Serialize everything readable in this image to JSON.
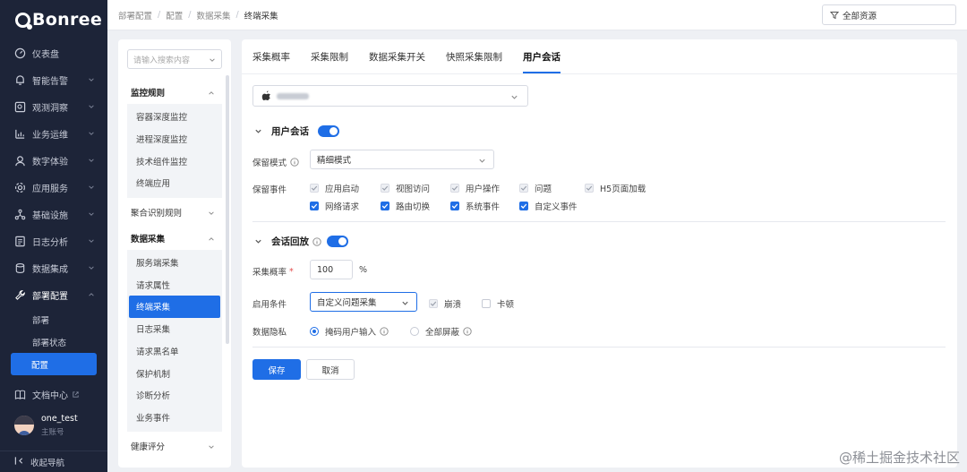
{
  "app": {
    "logo_text": "Bonree"
  },
  "nav": {
    "items": [
      {
        "label": "仪表盘",
        "icon": "dashboard-icon"
      },
      {
        "label": "智能告警",
        "icon": "alarm-icon"
      },
      {
        "label": "观测洞察",
        "icon": "insight-icon"
      },
      {
        "label": "业务运维",
        "icon": "chart-icon"
      },
      {
        "label": "数字体验",
        "icon": "experience-icon"
      },
      {
        "label": "应用服务",
        "icon": "app-service-icon"
      },
      {
        "label": "基础设施",
        "icon": "infrastructure-icon"
      },
      {
        "label": "日志分析",
        "icon": "log-icon"
      },
      {
        "label": "数据集成",
        "icon": "database-icon"
      },
      {
        "label": "部署配置",
        "icon": "wrench-icon"
      }
    ],
    "sub_items": [
      {
        "label": "部署"
      },
      {
        "label": "部署状态"
      },
      {
        "label": "配置"
      }
    ],
    "doc_center": "文档中心",
    "user": {
      "name": "one_test",
      "sub": "主账号"
    },
    "collapse_label": "收起导航"
  },
  "breadcrumb": [
    "部署配置",
    "配置",
    "数据采集",
    "终端采集"
  ],
  "resource_select": {
    "value": "全部资源"
  },
  "panel2": {
    "search_placeholder": "请输入搜索内容",
    "groups": [
      {
        "label": "监控规则",
        "items": [
          "容器深度监控",
          "进程深度监控",
          "技术组件监控",
          "终端应用"
        ]
      },
      {
        "label": "聚合识别规则",
        "items": []
      },
      {
        "label": "数据采集",
        "items": [
          "服务端采集",
          "请求属性",
          "终端采集",
          "日志采集",
          "请求黑名单",
          "保护机制",
          "诊断分析",
          "业务事件"
        ]
      },
      {
        "label": "健康评分",
        "items": []
      }
    ]
  },
  "tabs": [
    "采集概率",
    "采集限制",
    "数据采集开关",
    "快照采集限制",
    "用户会话"
  ],
  "session": {
    "title": "用户会话",
    "retain_mode_label": "保留模式",
    "retain_mode_value": "精细模式",
    "retain_events_label": "保留事件",
    "events_row1": [
      "应用启动",
      "视图访问",
      "用户操作",
      "问题",
      "H5页面加载"
    ],
    "events_row2": [
      "网络请求",
      "路由切换",
      "系统事件",
      "自定义事件"
    ]
  },
  "replay": {
    "title": "会话回放",
    "rate_label": "采集概率",
    "rate_value": "100",
    "rate_unit": "%",
    "enable_label": "启用条件",
    "enable_value": "自定义问题采集",
    "cond_crash": "崩溃",
    "cond_lag": "卡顿",
    "privacy_label": "数据隐私",
    "privacy_mask": "掩码用户输入",
    "privacy_block": "全部屏蔽"
  },
  "actions": {
    "save": "保存",
    "cancel": "取消"
  },
  "watermark": "@稀土掘金技术社区",
  "colors": {
    "accent": "#1f6ee6",
    "nav_bg": "#1d2438"
  }
}
